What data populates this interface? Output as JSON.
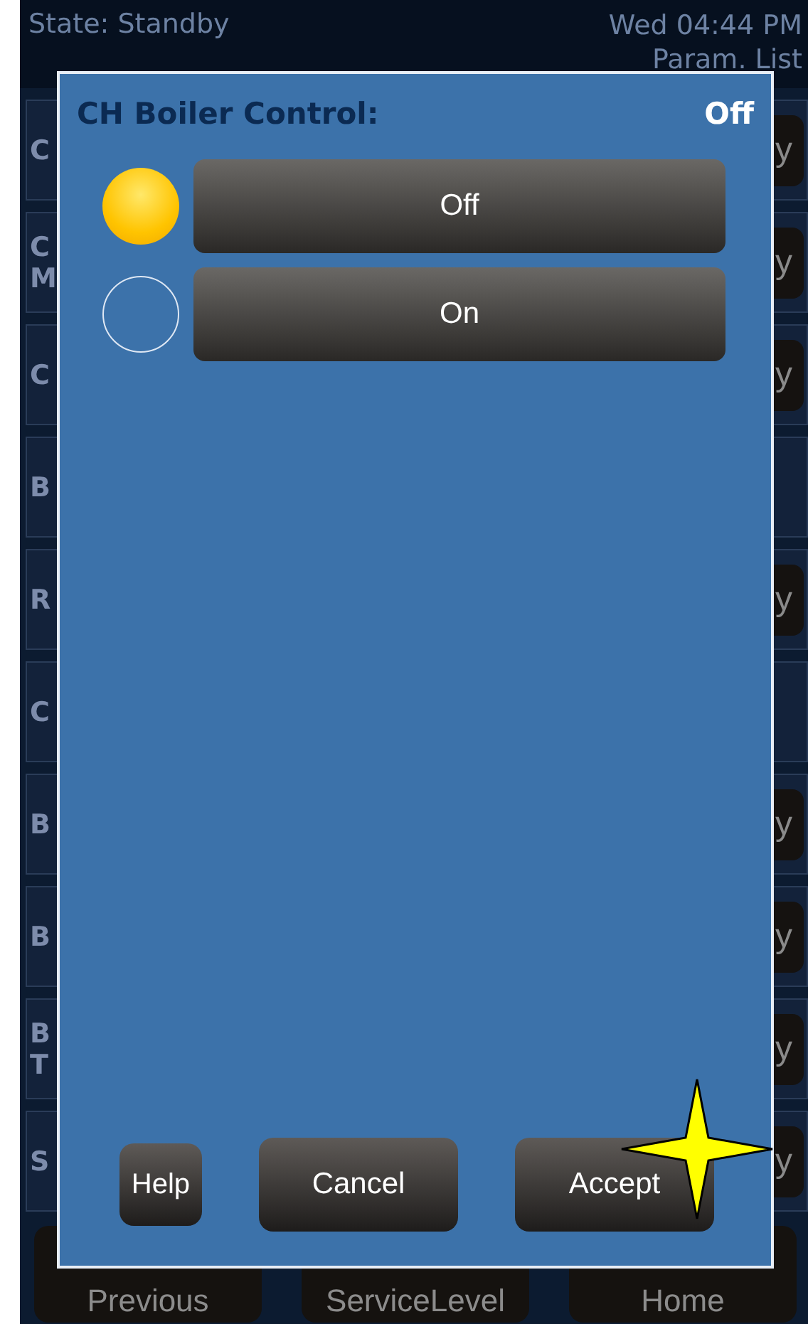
{
  "status_bar": {
    "state": "State: Standby",
    "datetime": "Wed 04:44 PM",
    "screen": "Param. List"
  },
  "background_rows": [
    {
      "label": [
        "C"
      ],
      "value_fragment": "y"
    },
    {
      "label": [
        "C",
        "M"
      ],
      "value_fragment": "y"
    },
    {
      "label": [
        "C"
      ],
      "value_fragment": "y"
    },
    {
      "label": [
        "B"
      ]
    },
    {
      "label": [
        "R"
      ],
      "value_fragment": "y"
    },
    {
      "label": [
        "C"
      ]
    },
    {
      "label": [
        "B"
      ],
      "value_fragment": "y"
    },
    {
      "label": [
        "B"
      ],
      "value_fragment": "y"
    },
    {
      "label": [
        "B",
        "T"
      ],
      "value_fragment": "y"
    },
    {
      "label": [
        "S"
      ],
      "value_fragment": "y"
    }
  ],
  "nav_buttons": [
    "Previous",
    "ServiceLevel",
    "Home"
  ],
  "dialog": {
    "title": "CH Boiler Control:",
    "current_value": "Off",
    "options": [
      {
        "label": "Off",
        "selected": true
      },
      {
        "label": "On",
        "selected": false
      }
    ],
    "buttons": [
      {
        "label": "Help",
        "kind": "small"
      },
      {
        "label": "Cancel",
        "kind": "wide"
      },
      {
        "label": "Accept",
        "kind": "wide"
      }
    ]
  },
  "annotation": {
    "kind": "star"
  }
}
